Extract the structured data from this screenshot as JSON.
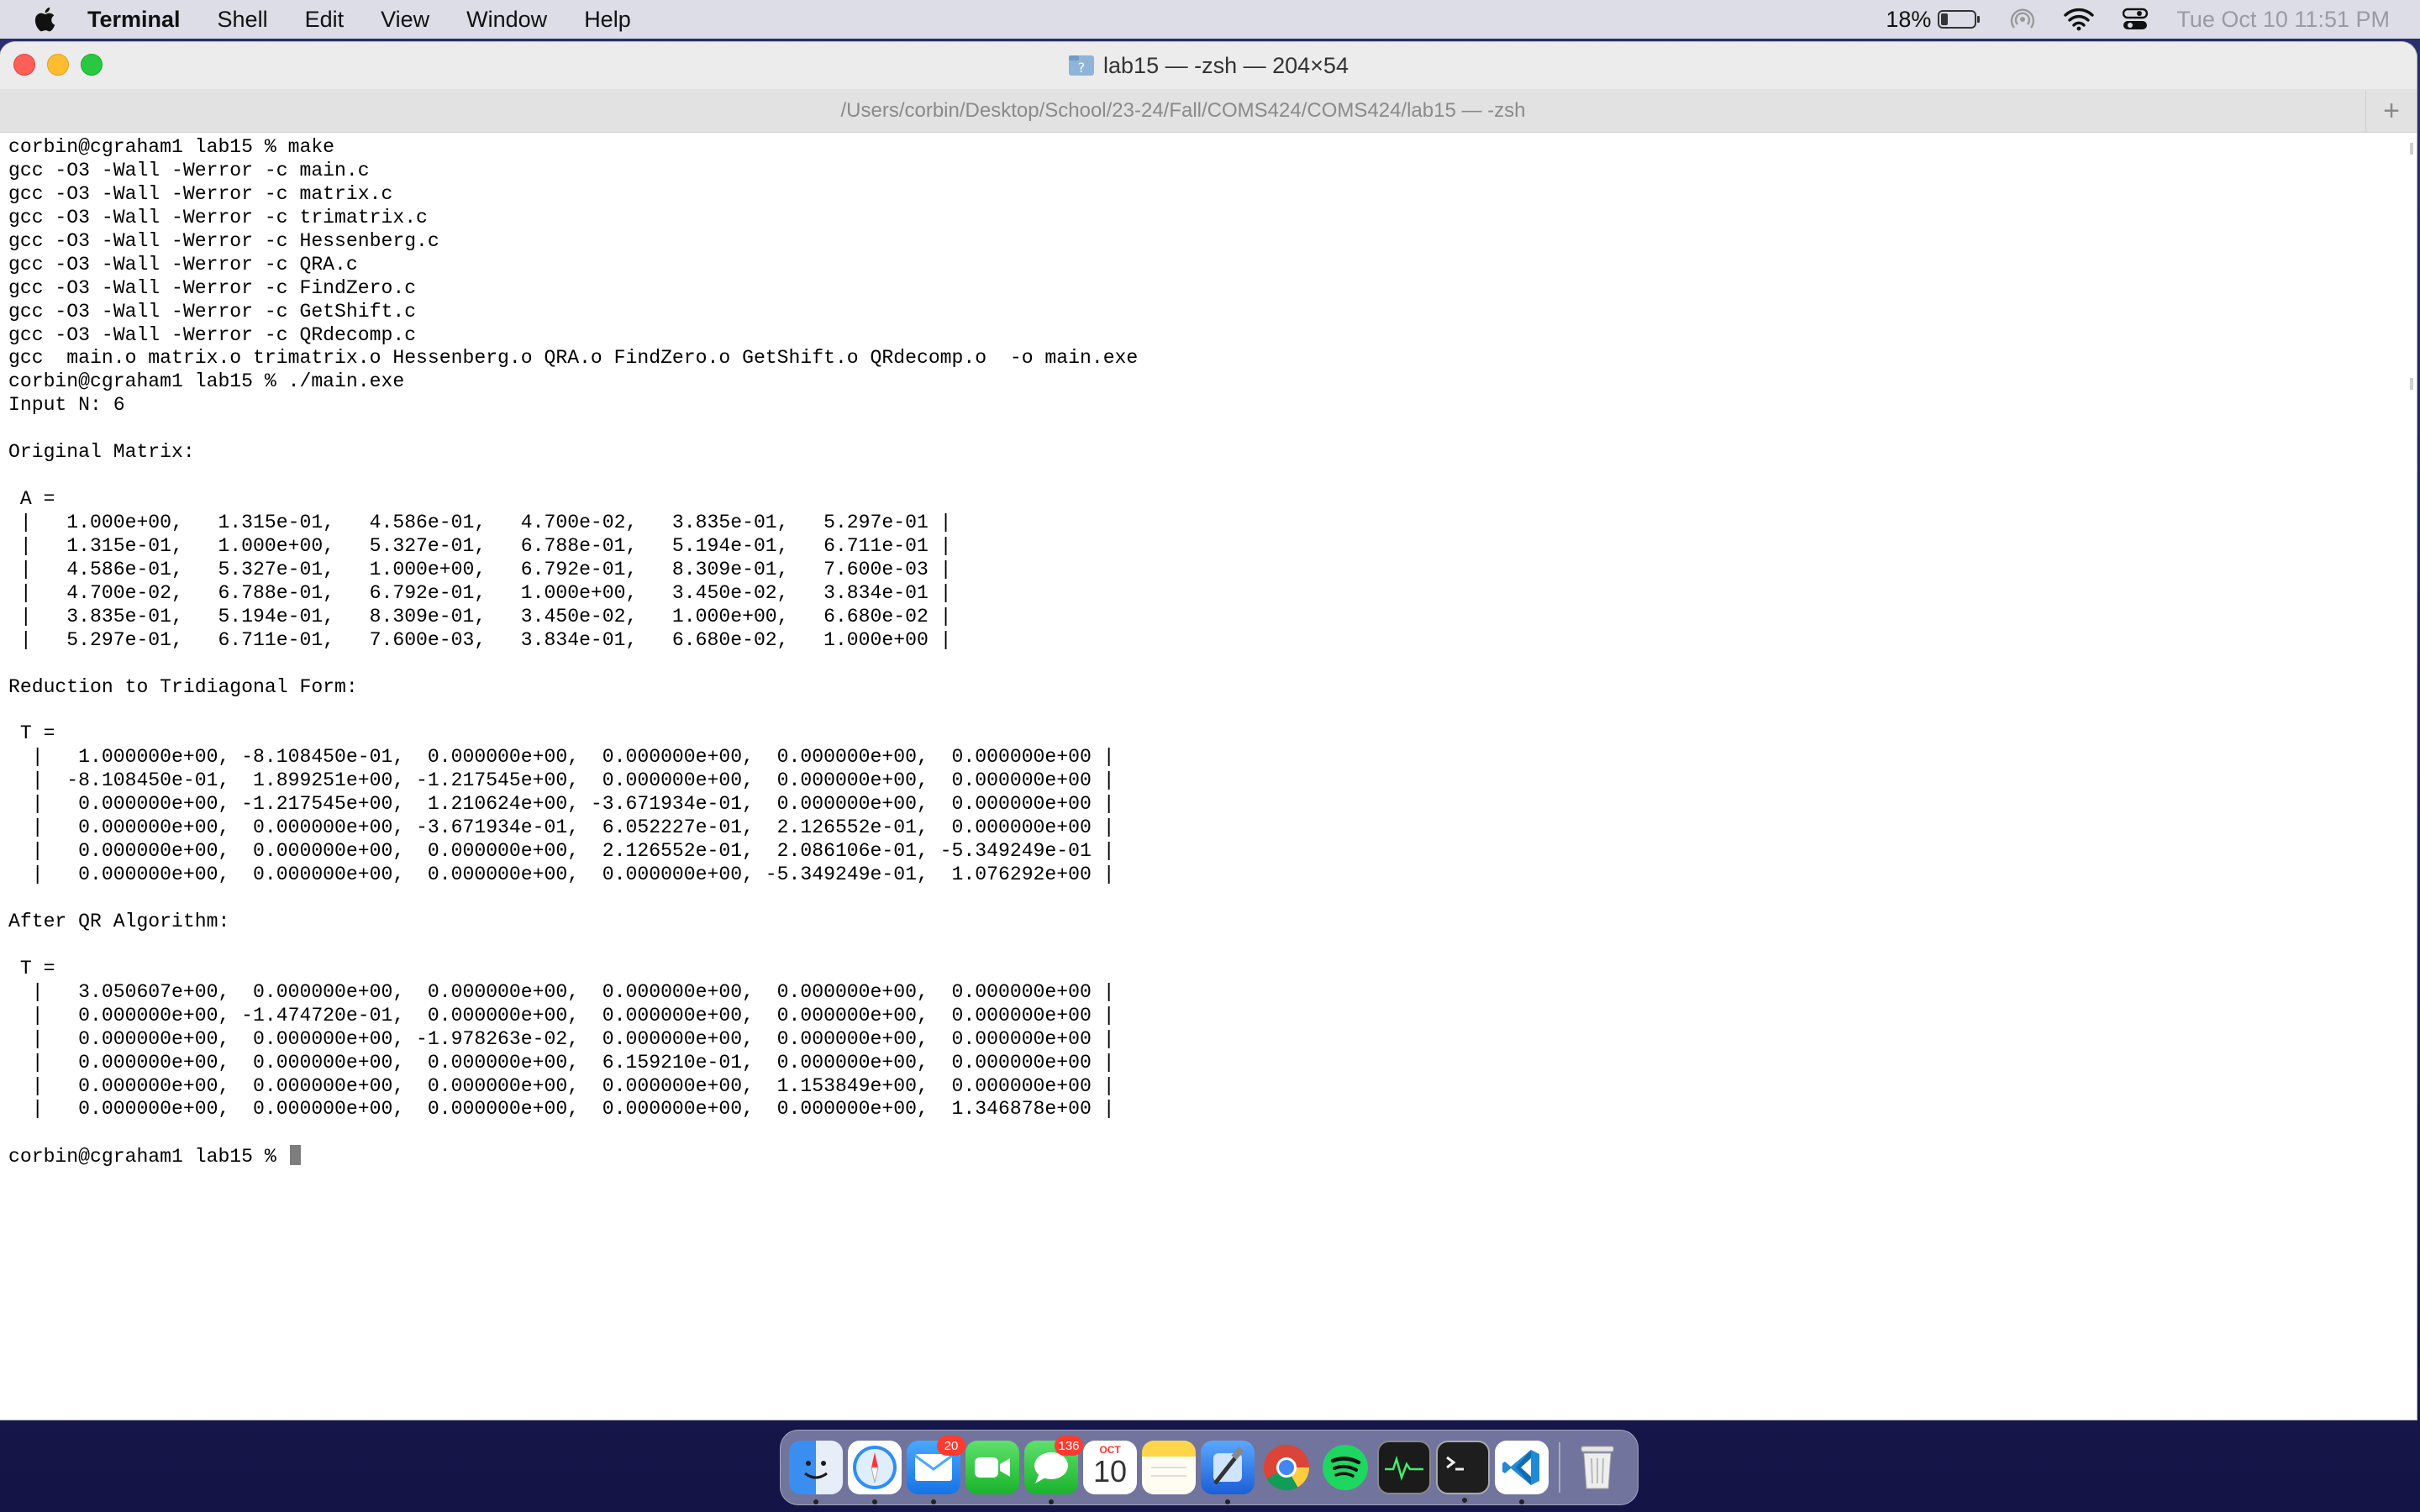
{
  "menubar": {
    "app_name": "Terminal",
    "items": [
      "Shell",
      "Edit",
      "View",
      "Window",
      "Help"
    ],
    "battery": "18%",
    "datetime": "Tue Oct 10  11:51 PM"
  },
  "window": {
    "title": "lab15 — -zsh — 204×54",
    "tab_path": "/Users/corbin/Desktop/School/23-24/Fall/COMS424/COMS424/lab15 — -zsh",
    "new_tab": "+"
  },
  "terminal": {
    "lines": [
      "corbin@cgraham1 lab15 % make",
      "gcc -O3 -Wall -Werror -c main.c",
      "gcc -O3 -Wall -Werror -c matrix.c",
      "gcc -O3 -Wall -Werror -c trimatrix.c",
      "gcc -O3 -Wall -Werror -c Hessenberg.c",
      "gcc -O3 -Wall -Werror -c QRA.c",
      "gcc -O3 -Wall -Werror -c FindZero.c",
      "gcc -O3 -Wall -Werror -c GetShift.c",
      "gcc -O3 -Wall -Werror -c QRdecomp.c",
      "gcc  main.o matrix.o trimatrix.o Hessenberg.o QRA.o FindZero.o GetShift.o QRdecomp.o  -o main.exe",
      "corbin@cgraham1 lab15 % ./main.exe",
      "Input N: 6",
      "",
      "Original Matrix:",
      "",
      " A =",
      " |   1.000e+00,   1.315e-01,   4.586e-01,   4.700e-02,   3.835e-01,   5.297e-01 |",
      " |   1.315e-01,   1.000e+00,   5.327e-01,   6.788e-01,   5.194e-01,   6.711e-01 |",
      " |   4.586e-01,   5.327e-01,   1.000e+00,   6.792e-01,   8.309e-01,   7.600e-03 |",
      " |   4.700e-02,   6.788e-01,   6.792e-01,   1.000e+00,   3.450e-02,   3.834e-01 |",
      " |   3.835e-01,   5.194e-01,   8.309e-01,   3.450e-02,   1.000e+00,   6.680e-02 |",
      " |   5.297e-01,   6.711e-01,   7.600e-03,   3.834e-01,   6.680e-02,   1.000e+00 |",
      "",
      "Reduction to Tridiagonal Form:",
      "",
      " T =",
      "  |   1.000000e+00, -8.108450e-01,  0.000000e+00,  0.000000e+00,  0.000000e+00,  0.000000e+00 |",
      "  |  -8.108450e-01,  1.899251e+00, -1.217545e+00,  0.000000e+00,  0.000000e+00,  0.000000e+00 |",
      "  |   0.000000e+00, -1.217545e+00,  1.210624e+00, -3.671934e-01,  0.000000e+00,  0.000000e+00 |",
      "  |   0.000000e+00,  0.000000e+00, -3.671934e-01,  6.052227e-01,  2.126552e-01,  0.000000e+00 |",
      "  |   0.000000e+00,  0.000000e+00,  0.000000e+00,  2.126552e-01,  2.086106e-01, -5.349249e-01 |",
      "  |   0.000000e+00,  0.000000e+00,  0.000000e+00,  0.000000e+00, -5.349249e-01,  1.076292e+00 |",
      "",
      "After QR Algorithm:",
      "",
      " T =",
      "  |   3.050607e+00,  0.000000e+00,  0.000000e+00,  0.000000e+00,  0.000000e+00,  0.000000e+00 |",
      "  |   0.000000e+00, -1.474720e-01,  0.000000e+00,  0.000000e+00,  0.000000e+00,  0.000000e+00 |",
      "  |   0.000000e+00,  0.000000e+00, -1.978263e-02,  0.000000e+00,  0.000000e+00,  0.000000e+00 |",
      "  |   0.000000e+00,  0.000000e+00,  0.000000e+00,  6.159210e-01,  0.000000e+00,  0.000000e+00 |",
      "  |   0.000000e+00,  0.000000e+00,  0.000000e+00,  0.000000e+00,  1.153849e+00,  0.000000e+00 |",
      "  |   0.000000e+00,  0.000000e+00,  0.000000e+00,  0.000000e+00,  0.000000e+00,  1.346878e+00 |",
      ""
    ],
    "prompt": "corbin@cgraham1 lab15 % "
  },
  "dock": {
    "apps": [
      {
        "name": "finder-icon",
        "running": true
      },
      {
        "name": "safari-icon",
        "running": true
      },
      {
        "name": "mail-icon",
        "badge": "20",
        "running": true
      },
      {
        "name": "facetime-icon"
      },
      {
        "name": "messages-icon",
        "badge": "136",
        "running": true
      },
      {
        "name": "calendar-icon",
        "month": "OCT",
        "day": "10"
      },
      {
        "name": "notes-icon"
      },
      {
        "name": "xcode-icon",
        "running": true
      },
      {
        "name": "chrome-icon"
      },
      {
        "name": "spotify-icon"
      },
      {
        "name": "activity-monitor-icon"
      },
      {
        "name": "terminal-icon",
        "running": true
      },
      {
        "name": "vscode-icon",
        "running": true
      },
      {
        "name": "trash-icon"
      }
    ]
  }
}
